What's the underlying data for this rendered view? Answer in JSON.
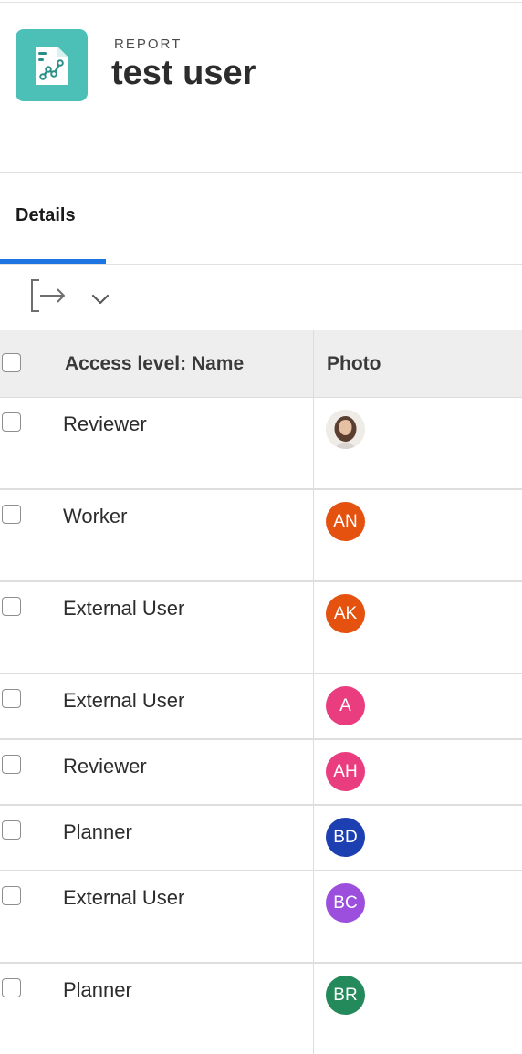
{
  "header": {
    "object_type": "REPORT",
    "title": "test user",
    "icon": "report-chart-icon",
    "icon_color": "#4cbfb6"
  },
  "tabs": [
    {
      "label": "Details",
      "active": true
    }
  ],
  "toolbar": {
    "export_icon": "export-icon",
    "dropdown_icon": "chevron-down-icon"
  },
  "table": {
    "columns": [
      "Access level: Name",
      "Photo"
    ],
    "rows": [
      {
        "access_level": "Reviewer",
        "photo": {
          "type": "photo",
          "initials": ""
        }
      },
      {
        "access_level": "Worker",
        "photo": {
          "type": "initials",
          "initials": "AN",
          "color": "#e5510f"
        }
      },
      {
        "access_level": "External User",
        "photo": {
          "type": "initials",
          "initials": "AK",
          "color": "#e5510f"
        }
      },
      {
        "access_level": "External User",
        "photo": {
          "type": "initials",
          "initials": "A",
          "color": "#ea3d7f"
        }
      },
      {
        "access_level": "Reviewer",
        "photo": {
          "type": "initials",
          "initials": "AH",
          "color": "#ea3d7f"
        }
      },
      {
        "access_level": "Planner",
        "photo": {
          "type": "initials",
          "initials": "BD",
          "color": "#1c3fb2"
        }
      },
      {
        "access_level": "External User",
        "photo": {
          "type": "initials",
          "initials": "BC",
          "color": "#9b4fdc"
        }
      },
      {
        "access_level": "Planner",
        "photo": {
          "type": "initials",
          "initials": "BR",
          "color": "#24895b"
        }
      }
    ]
  }
}
